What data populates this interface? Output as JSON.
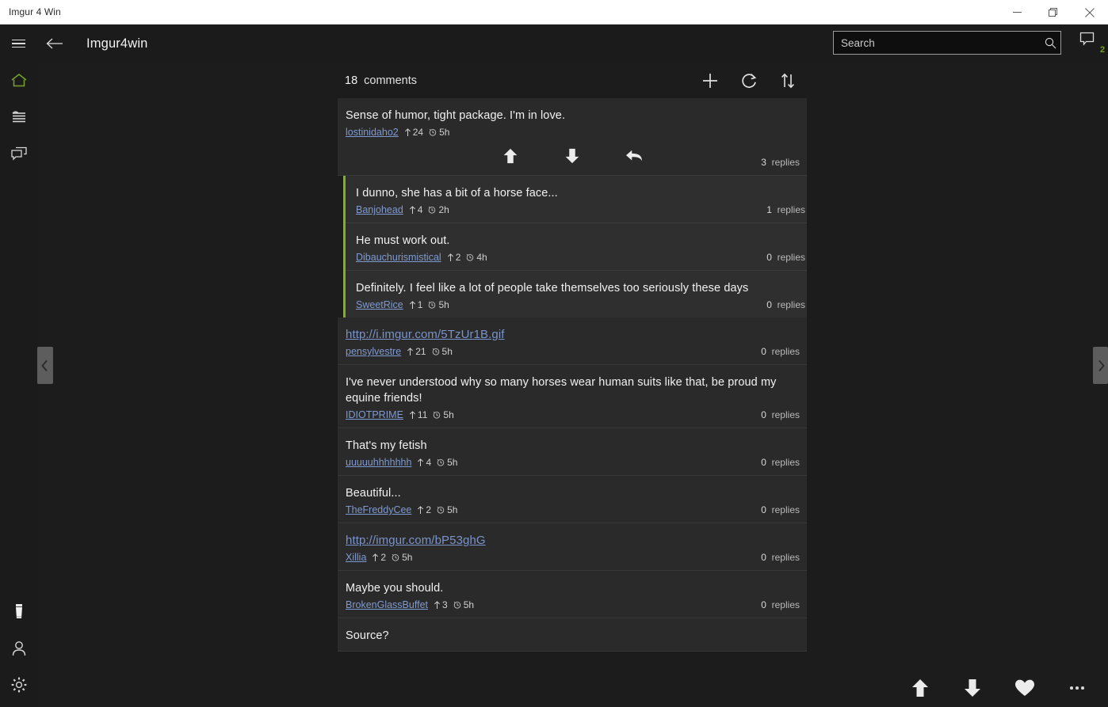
{
  "window": {
    "title": "Imgur 4 Win",
    "minimize_label": "minimize",
    "restore_label": "restore",
    "close_label": "close"
  },
  "appbar": {
    "menu_label": "menu",
    "back_label": "back",
    "title": "Imgur4win",
    "messages_badge": "2"
  },
  "search": {
    "placeholder": "Search",
    "value": ""
  },
  "rail": {
    "top_items": [
      {
        "icon": "home-icon",
        "label": "Home",
        "active": true,
        "color": "#76a22b"
      },
      {
        "icon": "feed-icon",
        "label": "Feed",
        "active": false,
        "color": "#d6d6d6"
      },
      {
        "icon": "comments-icon",
        "label": "Comments",
        "active": false,
        "color": "#d6d6d6"
      }
    ],
    "bottom_items": [
      {
        "icon": "beer-glass-icon",
        "label": "Donate",
        "color": "#e8e8e8"
      },
      {
        "icon": "account-icon",
        "label": "Account",
        "color": "#d6d6d6"
      },
      {
        "icon": "gear-icon",
        "label": "Settings",
        "color": "#d6d6d6"
      }
    ]
  },
  "pagenav": {
    "prev_label": "previous",
    "next_label": "next"
  },
  "header": {
    "count": "18",
    "count_word": "comments",
    "add_label": "add-comment",
    "refresh_label": "refresh",
    "sort_label": "sort"
  },
  "colors": {
    "accent_green": "#7cb518",
    "badge_green": "#76a22b",
    "link_blue": "#7f9ad0",
    "panel": "#2a2a2a",
    "panel_nested": "#2f2f2f",
    "page_bg": "#1c1c1c",
    "titlebar_bg": "#ffffff"
  },
  "comments": [
    {
      "text": "Sense of humor, tight package. I'm in love.",
      "is_link": false,
      "user": "lostinidaho2",
      "score": "24",
      "time": "5h",
      "replies_count": "3",
      "replies_word": "replies",
      "expanded": true,
      "actions": {
        "upvote_label": "upvote",
        "downvote_label": "downvote",
        "reply_label": "reply"
      },
      "replies": [
        {
          "text": "I dunno, she has a bit of a horse face...",
          "is_link": false,
          "user": "Banjohead",
          "score": "4",
          "time": "2h",
          "replies_count": "1",
          "replies_word": "replies"
        },
        {
          "text": "He must work out.",
          "is_link": false,
          "user": "Dibauchurismistical",
          "score": "2",
          "time": "4h",
          "replies_count": "0",
          "replies_word": "replies"
        },
        {
          "text": "Definitely. I feel like a lot of people take themselves too seriously these days",
          "is_link": false,
          "user": "SweetRice",
          "score": "1",
          "time": "5h",
          "replies_count": "0",
          "replies_word": "replies"
        }
      ]
    },
    {
      "text": "http://i.imgur.com/5TzUr1B.gif",
      "is_link": true,
      "user": "pensylvestre",
      "score": "21",
      "time": "5h",
      "replies_count": "0",
      "replies_word": "replies",
      "expanded": false,
      "replies": []
    },
    {
      "text": "I've never understood why so many horses wear human suits like that, be proud my equine friends!",
      "is_link": false,
      "user": "IDIOTPRIME",
      "score": "11",
      "time": "5h",
      "replies_count": "0",
      "replies_word": "replies",
      "expanded": false,
      "replies": []
    },
    {
      "text": "That's my fetish",
      "is_link": false,
      "user": "uuuuuhhhhhhh",
      "score": "4",
      "time": "5h",
      "replies_count": "0",
      "replies_word": "replies",
      "expanded": false,
      "replies": []
    },
    {
      "text": "Beautiful...",
      "is_link": false,
      "user": "TheFreddyCee",
      "score": "2",
      "time": "5h",
      "replies_count": "0",
      "replies_word": "replies",
      "expanded": false,
      "replies": []
    },
    {
      "text": "http://imgur.com/bP53ghG",
      "is_link": true,
      "user": "Xillia",
      "score": "2",
      "time": "5h",
      "replies_count": "0",
      "replies_word": "replies",
      "expanded": false,
      "replies": []
    },
    {
      "text": "Maybe you should.",
      "is_link": false,
      "user": "BrokenGlassBuffet",
      "score": "3",
      "time": "5h",
      "replies_count": "0",
      "replies_word": "replies",
      "expanded": false,
      "replies": []
    },
    {
      "text": "Source?",
      "is_link": false,
      "user": "",
      "score": "",
      "time": "",
      "replies_count": "",
      "replies_word": "",
      "expanded": false,
      "partial": true,
      "replies": []
    }
  ],
  "bottombar": {
    "upvote_label": "upvote",
    "downvote_label": "downvote",
    "favorite_label": "favorite",
    "more_label": "more"
  }
}
